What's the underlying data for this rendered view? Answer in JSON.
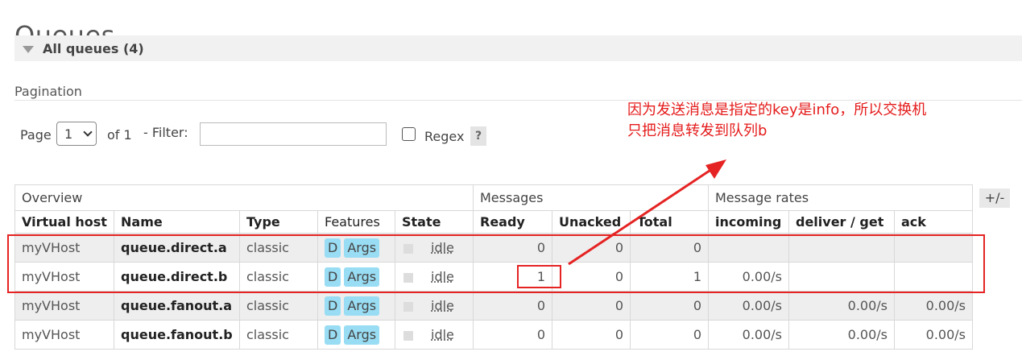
{
  "page": {
    "title": "Queues"
  },
  "section": {
    "label": "All queues (4)"
  },
  "pagination": {
    "label": "Pagination",
    "page_label": "Page",
    "page_value": "1",
    "of_label": "of 1",
    "filter_label": "- Filter:",
    "filter_value": "",
    "regex_label": "Regex",
    "help_label": "?"
  },
  "annotation": {
    "line1": "因为发送消息是指定的key是info，所以交换机",
    "line2": "只把消息转发到队列b",
    "color": "#e51b1b"
  },
  "table": {
    "group_headers": {
      "overview": "Overview",
      "messages": "Messages",
      "rates": "Message rates"
    },
    "columns": {
      "vhost": "Virtual host",
      "name": "Name",
      "type": "Type",
      "features": "Features",
      "state": "State",
      "ready": "Ready",
      "unacked": "Unacked",
      "total": "Total",
      "incoming": "incoming",
      "deliver_get": "deliver / get",
      "ack": "ack"
    },
    "toggle_label": "+/-",
    "rows": [
      {
        "vhost": "myVHost",
        "name": "queue.direct.a",
        "type": "classic",
        "feature_d": "D",
        "feature_args": "Args",
        "state": "idle",
        "ready": "0",
        "unacked": "0",
        "total": "0",
        "incoming": "",
        "deliver_get": "",
        "ack": ""
      },
      {
        "vhost": "myVHost",
        "name": "queue.direct.b",
        "type": "classic",
        "feature_d": "D",
        "feature_args": "Args",
        "state": "idle",
        "ready": "1",
        "unacked": "0",
        "total": "1",
        "incoming": "0.00/s",
        "deliver_get": "",
        "ack": ""
      },
      {
        "vhost": "myVHost",
        "name": "queue.fanout.a",
        "type": "classic",
        "feature_d": "D",
        "feature_args": "Args",
        "state": "idle",
        "ready": "0",
        "unacked": "0",
        "total": "0",
        "incoming": "0.00/s",
        "deliver_get": "0.00/s",
        "ack": "0.00/s"
      },
      {
        "vhost": "myVHost",
        "name": "queue.fanout.b",
        "type": "classic",
        "feature_d": "D",
        "feature_args": "Args",
        "state": "idle",
        "ready": "0",
        "unacked": "0",
        "total": "0",
        "incoming": "0.00/s",
        "deliver_get": "0.00/s",
        "ack": "0.00/s"
      }
    ]
  }
}
